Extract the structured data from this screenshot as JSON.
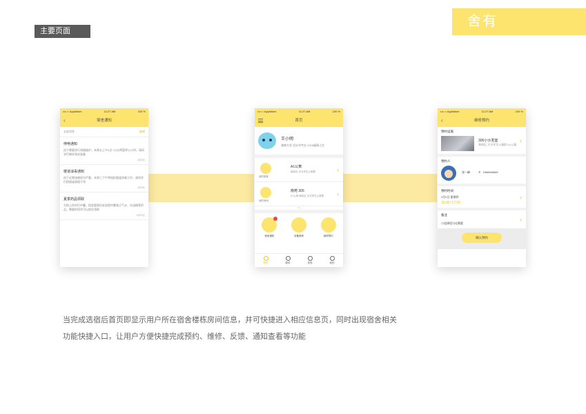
{
  "header": {
    "section_tag": "主要页面",
    "brand": "舍有"
  },
  "status_bar": {
    "carrier": "•••○○ Applidium",
    "time": "11:27 AM",
    "battery": "100 %"
  },
  "screen_notice": {
    "nav_title": "宿舍通知",
    "all_label": "全部消息",
    "edit_label": "编辑",
    "items": [
      {
        "title": "停电通知",
        "detail": "由于需要进行线路维护，本周五上午9点~12点将暂停公小时，请同学们做好相关准备",
        "date": "2月6日"
      },
      {
        "title": "楼道消毒通知",
        "detail": "由于近期流感较为严重，本周三下午将组织楼道消毒工作，请同学们把楼道清理干净",
        "date": "2月5日"
      },
      {
        "title": "夏季药品领取",
        "detail": "为防止同学们中暑，宿舍管理员处现提供藿香正气水、风油精等药品，需要的同学可以前往领取",
        "date": "1月30日"
      }
    ]
  },
  "screen_home": {
    "nav_title": "首页",
    "user": {
      "name": "王小明",
      "school": "湖南大学  设计学专业  2018级硕士生"
    },
    "rooms": [
      {
        "label": "我的楼栋",
        "title": "A1公寓",
        "sub": "南校区 天马学生公寓群"
      },
      {
        "label": "我的房间",
        "title": "南苑 305",
        "sub": "A1公寓 南校区 天马学生公寓群"
      }
    ],
    "shortcuts": [
      "宿舍通知",
      "设备报修",
      "维修预约"
    ],
    "tabs": [
      "首页",
      "服务",
      "发现",
      "我的"
    ]
  },
  "screen_booking": {
    "nav_title": "维修预约",
    "facility_label": "预约设施",
    "facility_name": "305小沙发室",
    "facility_sub": "南校区 天马学生公寓群 A1公寓",
    "person_label": "预约人",
    "person_name": "张一峰",
    "person_phone": "1888888888",
    "time_label": "预约时间",
    "date": "3月2日   星期四",
    "time_range": "15:00~17:00",
    "remark_label": "备注",
    "remark": "小组课程讨论需要",
    "confirm_button": "确认预约"
  },
  "description": {
    "line1": "当完成选宿后首页即显示用户所在宿舍楼栋房间信息，并可快捷进入相应信息页，同时出现宿舍相关",
    "line2": "功能快捷入口，让用户方便快捷完成预约、维修、反馈、通知查看等功能"
  },
  "colors": {
    "accent": "#fde46e",
    "band": "#fdeaa2",
    "tag_bg": "#5a5a5a"
  }
}
